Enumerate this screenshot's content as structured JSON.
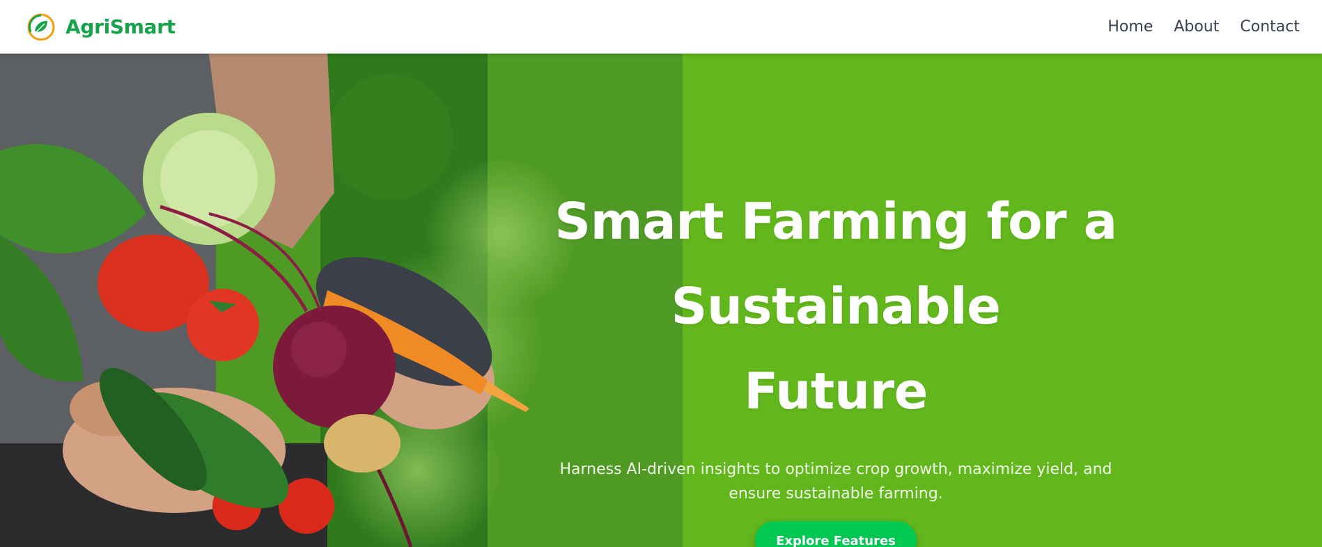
{
  "brand": {
    "name": "AgriSmart",
    "logo_icon": "leaf-logo-icon"
  },
  "nav": {
    "items": [
      {
        "label": "Home"
      },
      {
        "label": "About"
      },
      {
        "label": "Contact"
      }
    ]
  },
  "hero": {
    "title_line1": "Smart Farming for a Sustainable",
    "title_line2": "Future",
    "subtitle_line1": "Harness AI-driven insights to optimize crop growth, maximize yield, and",
    "subtitle_line2": "ensure sustainable farming.",
    "cta_label": "Explore Features",
    "image_subject": "hands holding fresh vegetables"
  },
  "colors": {
    "brand_green": "#16a34a",
    "hero_green": "#62b71c",
    "cta_green": "#00c853",
    "nav_text": "#374151"
  }
}
